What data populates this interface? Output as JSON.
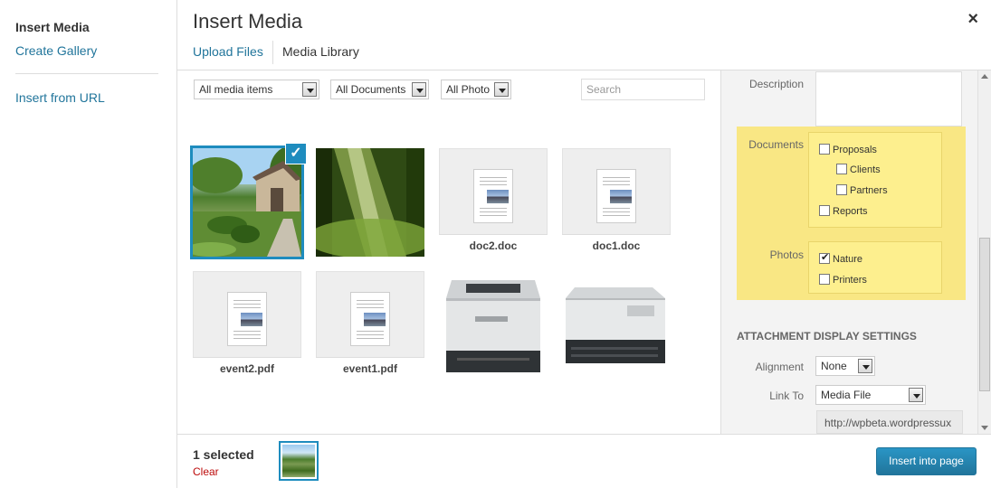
{
  "menu": {
    "title": "Insert Media",
    "gallery": "Create Gallery",
    "from_url": "Insert from URL"
  },
  "header": {
    "title": "Insert Media",
    "close": "×",
    "tab_upload": "Upload Files",
    "tab_library": "Media Library"
  },
  "filters": {
    "media": "All media items",
    "documents": "All Documents",
    "photo": "All Photo",
    "search_placeholder": "Search"
  },
  "thumbs": {
    "doc2": "doc2.doc",
    "doc1": "doc1.doc",
    "event2": "event2.pdf",
    "event1": "event1.pdf",
    "check": "✓"
  },
  "sidebar": {
    "description": "Description",
    "documents": "Documents",
    "proposals": "Proposals",
    "clients": "Clients",
    "partners": "Partners",
    "reports": "Reports",
    "photos": "Photos",
    "nature": "Nature",
    "printers": "Printers",
    "display_title": "ATTACHMENT DISPLAY SETTINGS",
    "alignment": "Alignment",
    "alignment_value": "None",
    "link_to": "Link To",
    "link_to_value": "Media File",
    "url_value": "http://wpbeta.wordpressux"
  },
  "toolbar": {
    "count": "1 selected",
    "clear": "Clear",
    "insert": "Insert into page"
  },
  "colors": {
    "accent": "#1e8cbe",
    "link": "#21759b",
    "highlight": "#f9e784",
    "danger": "#bc0b0b"
  }
}
